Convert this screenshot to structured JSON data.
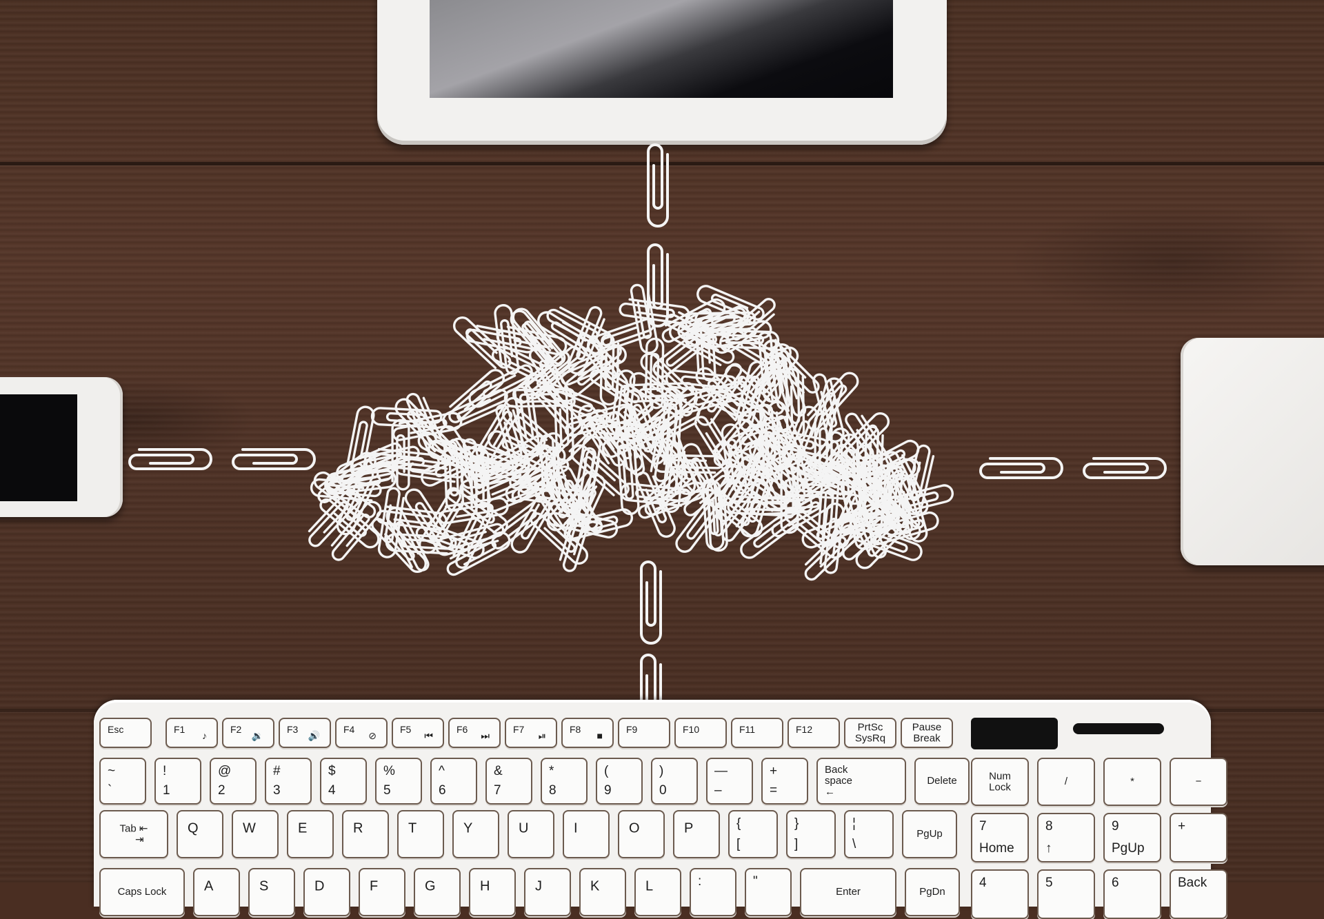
{
  "scene": {
    "description": "Top-down photo of a wooden desk with a tablet, smartphone, external hard drive and keyboard connected by paperclip chains to a central cloud made of paperclips",
    "colors": {
      "wood": "#4b3023",
      "device_white": "#f2f1ef",
      "screen_black": "#0a0a0c",
      "paperclip": "#f4f4f4",
      "key_outline": "#6b5a4e"
    }
  },
  "devices": {
    "tablet": {
      "label": "tablet"
    },
    "phone": {
      "label": "smartphone"
    },
    "drive": {
      "label": "external hard drive"
    },
    "cloud": {
      "label": "paperclip cloud"
    }
  },
  "keyboard": {
    "function_row": [
      {
        "label": "Esc",
        "icon": ""
      },
      {
        "label": "F1",
        "icon": "♪"
      },
      {
        "label": "F2",
        "icon": "🔉"
      },
      {
        "label": "F3",
        "icon": "🔊"
      },
      {
        "label": "F4",
        "icon": "⊘"
      },
      {
        "label": "F5",
        "icon": "⏮"
      },
      {
        "label": "F6",
        "icon": "⏭"
      },
      {
        "label": "F7",
        "icon": "⏯"
      },
      {
        "label": "F8",
        "icon": "■"
      },
      {
        "label": "F9",
        "icon": ""
      },
      {
        "label": "F10",
        "icon": ""
      },
      {
        "label": "F11",
        "icon": ""
      },
      {
        "label": "F12",
        "icon": ""
      },
      {
        "label": "PrtSc\nSysRq",
        "icon": ""
      },
      {
        "label": "Pause\nBreak",
        "icon": ""
      }
    ],
    "number_row": [
      {
        "top": "~",
        "bottom": "`"
      },
      {
        "top": "!",
        "bottom": "1"
      },
      {
        "top": "@",
        "bottom": "2"
      },
      {
        "top": "#",
        "bottom": "3"
      },
      {
        "top": "$",
        "bottom": "4"
      },
      {
        "top": "%",
        "bottom": "5"
      },
      {
        "top": "^",
        "bottom": "6"
      },
      {
        "top": "&",
        "bottom": "7"
      },
      {
        "top": "*",
        "bottom": "8"
      },
      {
        "top": "(",
        "bottom": "9"
      },
      {
        "top": ")",
        "bottom": "0"
      },
      {
        "top": "—",
        "bottom": "–"
      },
      {
        "top": "+",
        "bottom": "="
      }
    ],
    "backspace": "Back\nspace\n←",
    "delete": "Delete",
    "tab": "Tab ⇤\n    ⇥",
    "qwerty_row": [
      "Q",
      "W",
      "E",
      "R",
      "T",
      "Y",
      "U",
      "I",
      "O",
      "P"
    ],
    "bracket_keys": [
      {
        "top": "{",
        "bottom": "["
      },
      {
        "top": "}",
        "bottom": "]"
      },
      {
        "top": "¦",
        "bottom": "\\"
      }
    ],
    "pgup": "PgUp",
    "caps_lock": "Caps Lock",
    "home_row": [
      "A",
      "S",
      "D",
      "F",
      "G",
      "H",
      "J",
      "K",
      "L"
    ],
    "home_row_extra": [
      {
        "top": ":",
        "bottom": ""
      },
      {
        "top": "\"",
        "bottom": ""
      }
    ],
    "enter": "Enter",
    "pgdn": "PgDn",
    "numpad": {
      "row1": [
        "Num\nLock",
        "/",
        "*",
        "−"
      ],
      "row2": [
        {
          "top": "7",
          "bottom": "Home"
        },
        {
          "top": "8",
          "bottom": "↑"
        },
        {
          "top": "9",
          "bottom": "PgUp"
        },
        {
          "top": "+",
          "bottom": ""
        }
      ],
      "row3": [
        {
          "top": "4",
          "bottom": ""
        },
        {
          "top": "5",
          "bottom": ""
        },
        {
          "top": "6",
          "bottom": ""
        },
        {
          "top": "Back",
          "bottom": ""
        }
      ]
    }
  }
}
